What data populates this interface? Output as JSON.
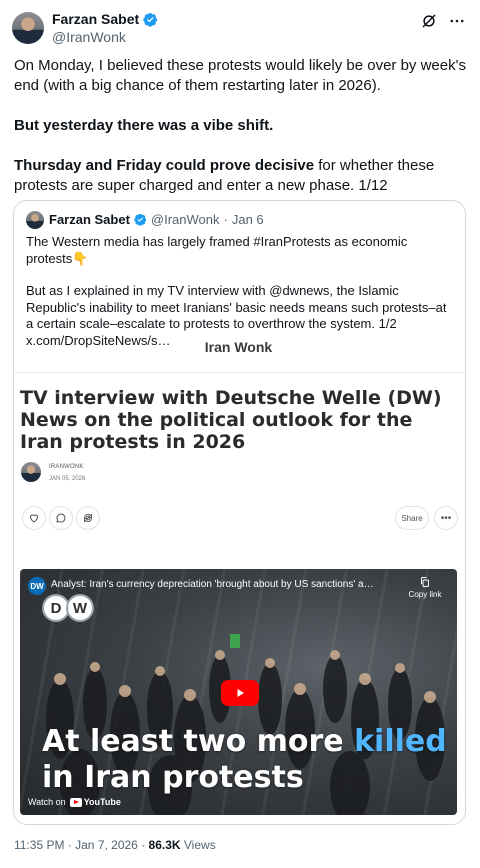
{
  "author": {
    "name": "Farzan Sabet",
    "handle": "@IranWonk"
  },
  "tweet": {
    "p1": "On Monday, I believed these protests would likely be over by week's end (with a big chance of them restarting later in 2026).",
    "p2": "But yesterday there was a vibe shift.",
    "p3_bold": "Thursday and Friday could prove decisive",
    "p3_rest": " for whether these protests are super charged and enter a new phase. 1/12"
  },
  "quote": {
    "name": "Farzan Sabet",
    "handle": "@IranWonk",
    "separator": "·",
    "date": "Jan 6",
    "p1": "The Western media has largely framed #IranProtests as economic protests👇",
    "p2": "But as I explained in my TV interview with @dwnews, the Islamic Republic's inability to meet Iranians' basic needs means such protests–at a certain scale–escalate to protests to overthrow the system. 1/2  x.com/DropSiteNews/s…",
    "banner_title": "Iran Wonk",
    "article_title": "TV interview with Deutsche Welle (DW) News on the political outlook for the Iran protests in 2026",
    "article_author": "IRANWONK",
    "article_date": "JAN 05, 2026",
    "share_label": "Share",
    "video": {
      "logo": "DW",
      "title": "Analyst: Iran's currency depreciation 'brought about by US sanctions' a…",
      "copy_label": "Copy link",
      "headline_part1": "At least two more ",
      "headline_highlight": "killed",
      "headline_line2": "in Iran protests",
      "watch_on": "Watch on",
      "youtube": "YouTube"
    }
  },
  "footer": {
    "time": "11:35 PM · Jan 7, 2026 · ",
    "views_count": "86.3K",
    "views_label": " Views"
  },
  "colors": {
    "verified": "#1d9bf0",
    "headline_highlight": "#4fb6ff",
    "play": "#ff0000"
  },
  "icons": [
    "verified-badge-icon",
    "grok-icon",
    "more-icon",
    "heart-icon",
    "comment-icon",
    "restack-icon",
    "copy-icon",
    "play-icon",
    "youtube-icon"
  ]
}
